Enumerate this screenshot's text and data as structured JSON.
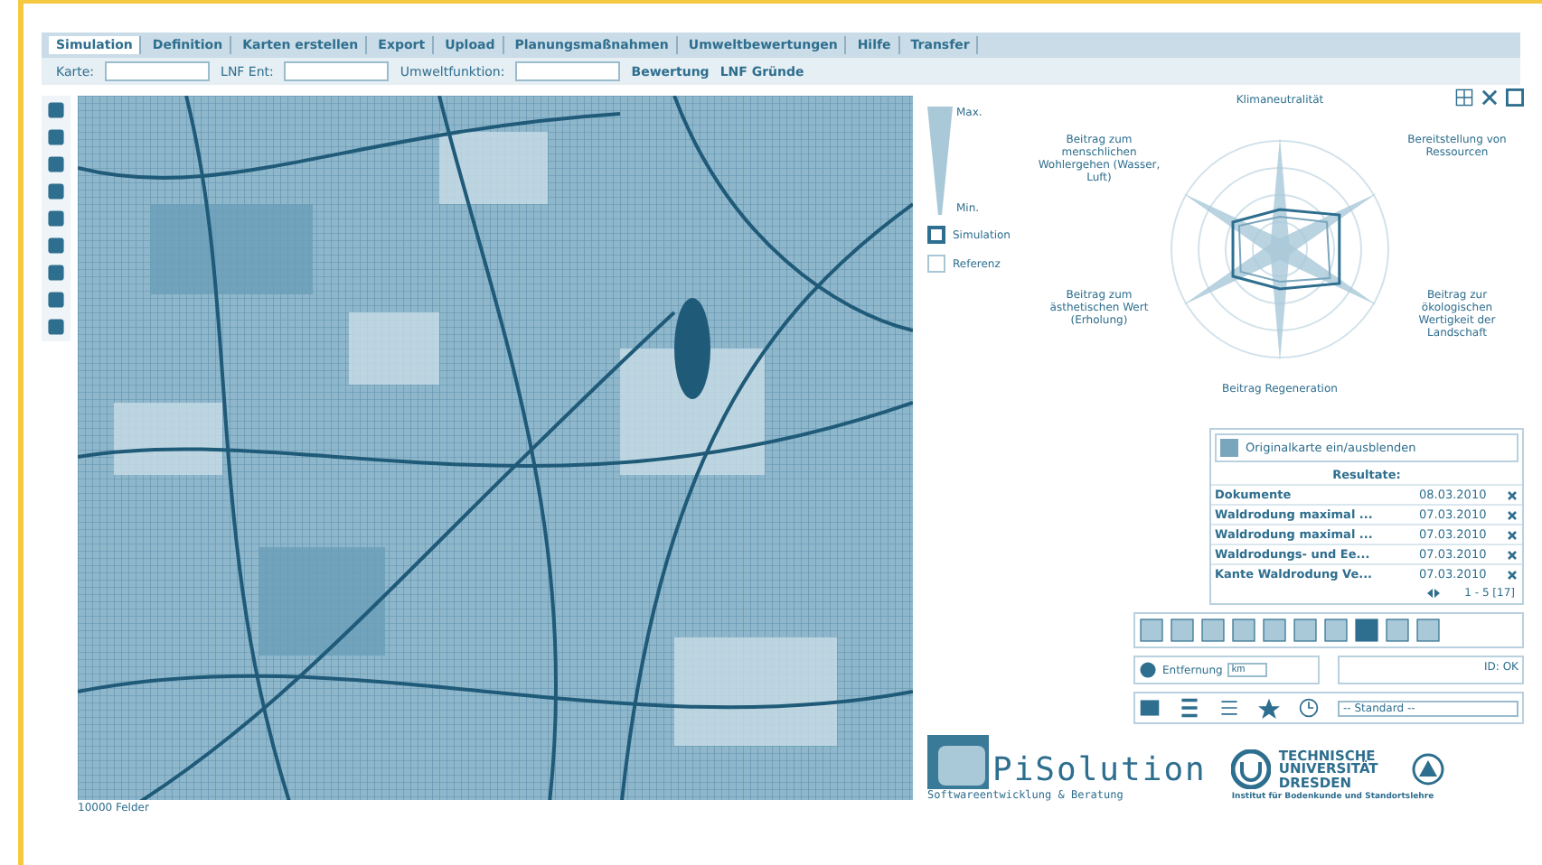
{
  "tabs": [
    {
      "label": "Simulation",
      "selected": true
    },
    {
      "label": "Definition",
      "selected": false
    },
    {
      "label": "Karten erstellen",
      "selected": false
    },
    {
      "label": "Export",
      "selected": false
    },
    {
      "label": "Upload",
      "selected": false
    },
    {
      "label": "Planungsmaßnahmen",
      "selected": false
    },
    {
      "label": "Umweltbewertungen",
      "selected": false
    },
    {
      "label": "Hilfe",
      "selected": false
    },
    {
      "label": "Transfer",
      "selected": false
    }
  ],
  "toolbar": {
    "fields": [
      {
        "label": "Karte:"
      },
      {
        "label": "LNF Ent:"
      },
      {
        "label": "Umweltfunktion:"
      }
    ],
    "links": [
      "Bewertung",
      "LNF Gründe"
    ]
  },
  "map": {
    "caption": "10000 Felder"
  },
  "chart": {
    "max_label": "Max.",
    "min_label": "Min.",
    "legend": [
      {
        "label": "Simulation",
        "kind": "simulation"
      },
      {
        "label": "Referenz",
        "kind": "reference"
      }
    ],
    "axes": [
      "Klimaneutralität",
      "Beitrag zum menschlichen Wohlergehen (Wasser, Luft)",
      "Bereitstellung von Ressourcen",
      "Beitrag zum ästhetischen Wert (Erholung)",
      "Beitrag zur ökologischen Wertigkeit der Landschaft",
      "Beitrag Regeneration"
    ]
  },
  "results": {
    "toggle": "Originalkarte ein/ausblenden",
    "header": "Resultate:",
    "rows": [
      {
        "name": "Dokumente",
        "date": "08.03.2010"
      },
      {
        "name": "Waldrodung maximal ...",
        "date": "07.03.2010"
      },
      {
        "name": "Waldrodung maximal ...",
        "date": "07.03.2010"
      },
      {
        "name": "Waldrodungs- und Ee...",
        "date": "07.03.2010"
      },
      {
        "name": "Kante Waldrodung Ve...",
        "date": "07.03.2010"
      }
    ],
    "pager": "1 - 5 [17]"
  },
  "distance": {
    "label": "Entfernung",
    "value": "km"
  },
  "status": "ID: OK",
  "style_select": "-- Standard --",
  "logos": {
    "company": "PiSolution",
    "company_tagline": "Softwareentwicklung & Beratung",
    "university": "TECHNISCHE UNIVERSITÄT DRESDEN",
    "institute": "Institut für Bodenkunde und Standortslehre"
  }
}
